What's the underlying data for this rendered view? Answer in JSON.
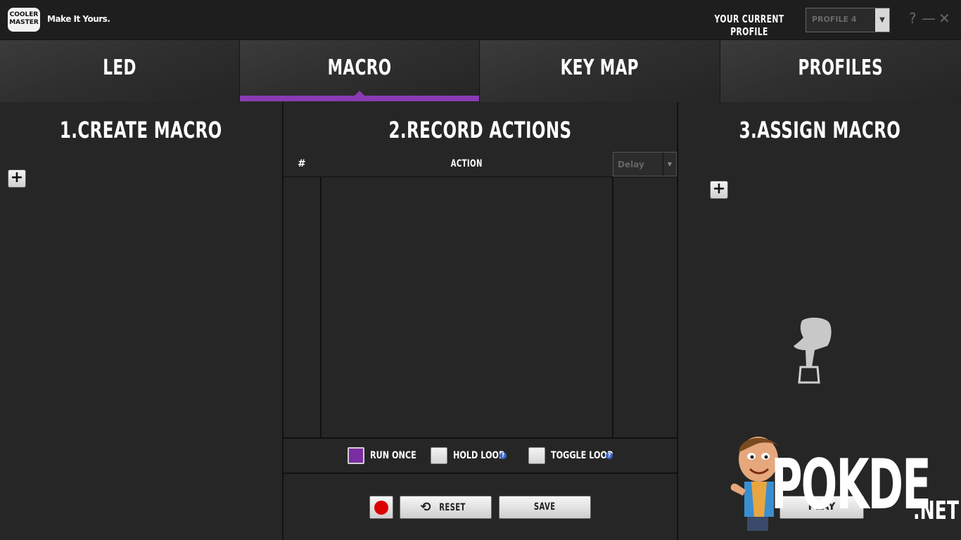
{
  "app": {
    "logo_text_1": "COOLER",
    "logo_text_2": "MASTER",
    "tagline": "Make It Yours."
  },
  "profile": {
    "label": "YOUR CURRENT PROFILE",
    "value": "PROFILE 4"
  },
  "window_controls": {
    "help": "?",
    "minimize": "—",
    "close": "✕"
  },
  "tabs": [
    {
      "label": "LED",
      "active": false
    },
    {
      "label": "MACRO",
      "active": true
    },
    {
      "label": "KEY MAP",
      "active": false
    },
    {
      "label": "PROFILES",
      "active": false
    }
  ],
  "panels": {
    "create": {
      "title": "1.CREATE MACRO",
      "add_label": "+"
    },
    "record": {
      "title": "2.RECORD ACTIONS",
      "col_number": "#",
      "col_action": "ACTION",
      "delay_value": "Delay",
      "options": [
        {
          "label": "RUN ONCE",
          "checked": true
        },
        {
          "label": "HOLD LOOP",
          "checked": false
        },
        {
          "label": "TOGGLE LOOP",
          "checked": false
        }
      ],
      "help_glyph": "?",
      "reset_label": "RESET",
      "save_label": "SAVE"
    },
    "assign": {
      "title": "3.ASSIGN MACRO",
      "add_label": "+",
      "play_label": "PLAY"
    }
  },
  "watermark": {
    "text": "POKDE",
    "suffix": ".NET"
  },
  "colors": {
    "accent": "#8b3bb3",
    "record": "#dd0000",
    "help": "#3d67c8",
    "background": "#262626"
  },
  "icons": {
    "record": "record-dot-icon",
    "reset": "undo-icon",
    "assign_hint": "hand-pressing-key-icon"
  }
}
